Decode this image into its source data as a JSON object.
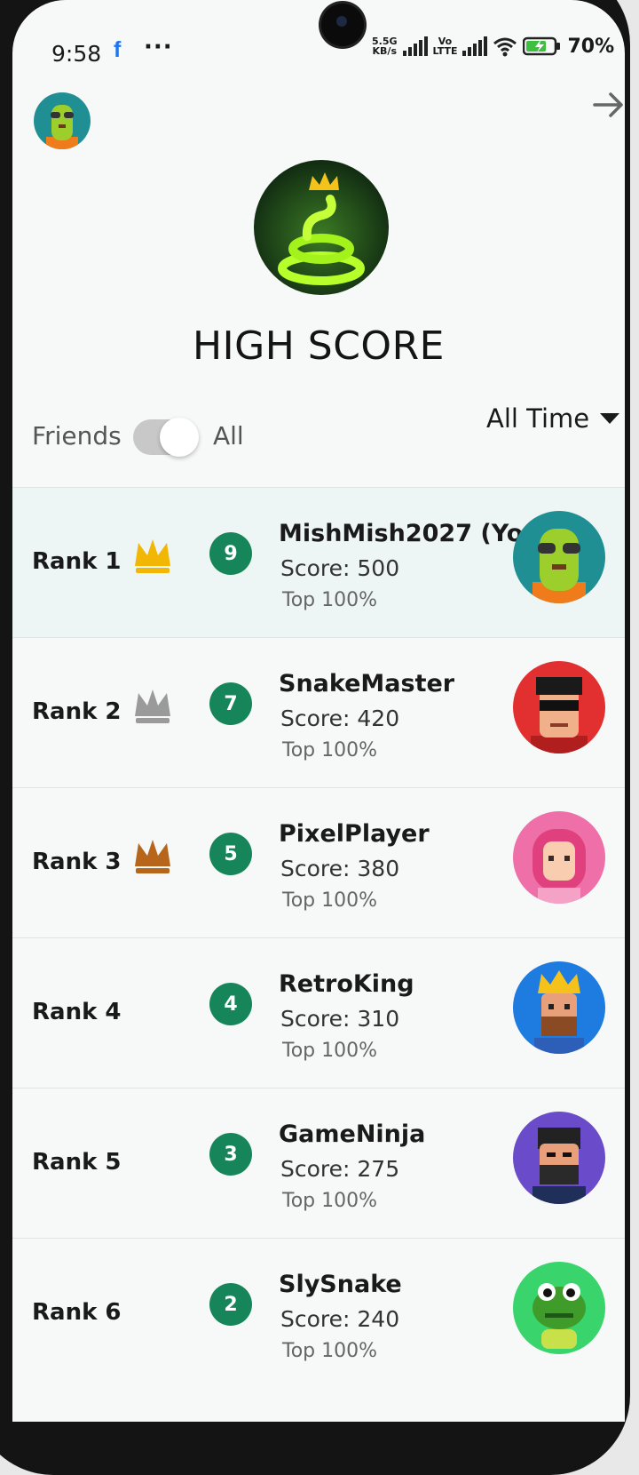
{
  "status": {
    "time": "9:58",
    "fb": "f",
    "dots": "···",
    "net1": "5.5G",
    "net1_sub": "KB/s",
    "net2": "Vo",
    "net2_sub": "LTTE",
    "battery": "70%"
  },
  "title": "HIGH SCORE",
  "filters": {
    "friends_label": "Friends",
    "all_label": "All",
    "toggle_on": true,
    "time_range": "All Time"
  },
  "colors": {
    "badge": "#17855a",
    "gold": "#f2b705",
    "silver": "#9a9a9a",
    "bronze": "#b8651c",
    "highlight_row": "#eef5f5"
  },
  "players": [
    {
      "rank": "Rank 1",
      "level": "9",
      "name": "MishMish2027 (You)",
      "score": "Score: 500",
      "top": "Top 100%",
      "crown": "gold-crown-icon",
      "avatar": "snake-sunglasses-avatar"
    },
    {
      "rank": "Rank 2",
      "level": "7",
      "name": "SnakeMaster",
      "score": "Score:  420",
      "top": "Top 100%",
      "crown": "silver-crown-icon",
      "avatar": "sunglasses-guy-avatar"
    },
    {
      "rank": "Rank 3",
      "level": "5",
      "name": "PixelPlayer",
      "score": "Score: 380",
      "top": "Top 100%",
      "crown": "bronze-crown-icon",
      "avatar": "pink-hair-girl-avatar"
    },
    {
      "rank": "Rank  4",
      "level": "4",
      "name": "RetroKing",
      "score": "Score: 310",
      "top": "Top 100%",
      "crown": null,
      "avatar": "king-avatar"
    },
    {
      "rank": "Rank 5",
      "level": "3",
      "name": "GameNinja",
      "score": "Score: 275",
      "top": "Top 100%",
      "crown": null,
      "avatar": "ninja-avatar"
    },
    {
      "rank": "Rank 6",
      "level": "2",
      "name": "SlySnake",
      "score": "Score: 240",
      "top": "Top 100%",
      "crown": null,
      "avatar": "green-snake-avatar"
    }
  ]
}
